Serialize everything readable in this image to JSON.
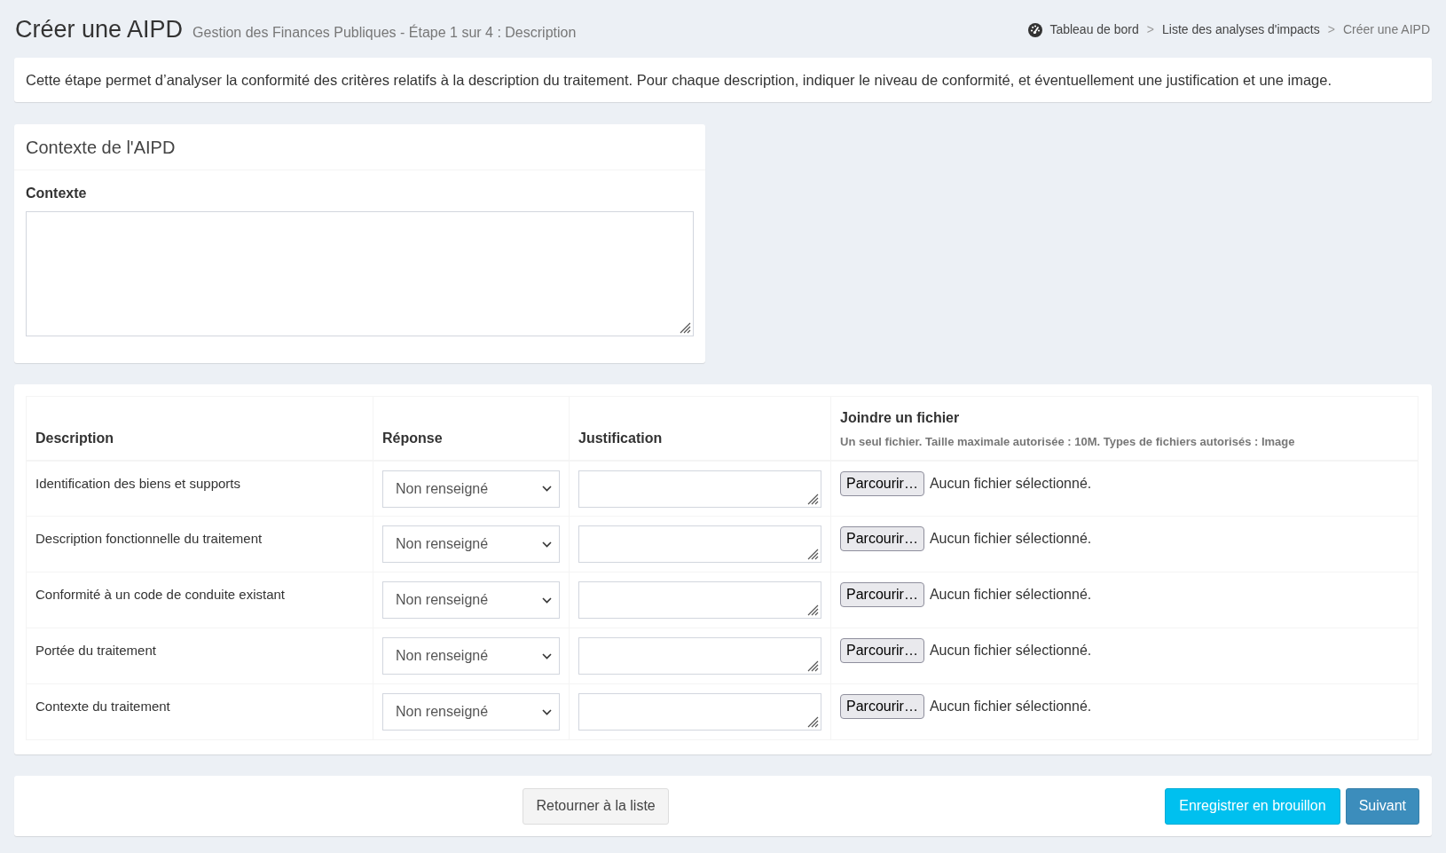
{
  "header": {
    "title": "Créer une AIPD",
    "subtitle": "Gestion des Finances Publiques - Étape 1 sur 4 : Description"
  },
  "breadcrumb": [
    {
      "kind": "home",
      "label": "Tableau de bord"
    },
    {
      "kind": "link",
      "separator": ">",
      "label": "Liste des analyses d'impacts"
    },
    {
      "kind": "current",
      "separator": ">",
      "label": "Créer une AIPD"
    }
  ],
  "intro": "Cette étape permet d’analyser la conformité des critères relatifs à la description du traitement. Pour chaque description, indiquer le niveau de conformité, et éventuellement une justification et une image.",
  "context_card": {
    "title": "Contexte de l'AIPD",
    "field_label": "Contexte"
  },
  "table": {
    "columns": [
      {
        "label": "Description"
      },
      {
        "label": "Réponse"
      },
      {
        "label": "Justification"
      },
      {
        "label": "Joindre un fichier",
        "hint": "Un seul fichier. Taille maximale autorisée : 10M. Types de fichiers autorisés : Image"
      }
    ],
    "rows": [
      {
        "description": "Identification des biens et supports",
        "response": "Non renseigné",
        "file_button": "Parcourir…",
        "file_status": "Aucun fichier sélectionné."
      },
      {
        "description": "Description fonctionnelle du traitement",
        "response": "Non renseigné",
        "file_button": "Parcourir…",
        "file_status": "Aucun fichier sélectionné."
      },
      {
        "description": "Conformité à un code de conduite existant",
        "response": "Non renseigné",
        "file_button": "Parcourir…",
        "file_status": "Aucun fichier sélectionné."
      },
      {
        "description": "Portée du traitement",
        "response": "Non renseigné",
        "file_button": "Parcourir…",
        "file_status": "Aucun fichier sélectionné."
      },
      {
        "description": "Contexte du traitement",
        "response": "Non renseigné",
        "file_button": "Parcourir…",
        "file_status": "Aucun fichier sélectionné."
      }
    ]
  },
  "footer": {
    "buttons": [
      {
        "kind": "default",
        "label": "Retourner à la liste"
      },
      {
        "kind": "info",
        "label": "Enregistrer en brouillon"
      },
      {
        "kind": "primary",
        "label": "Suivant"
      }
    ]
  }
}
